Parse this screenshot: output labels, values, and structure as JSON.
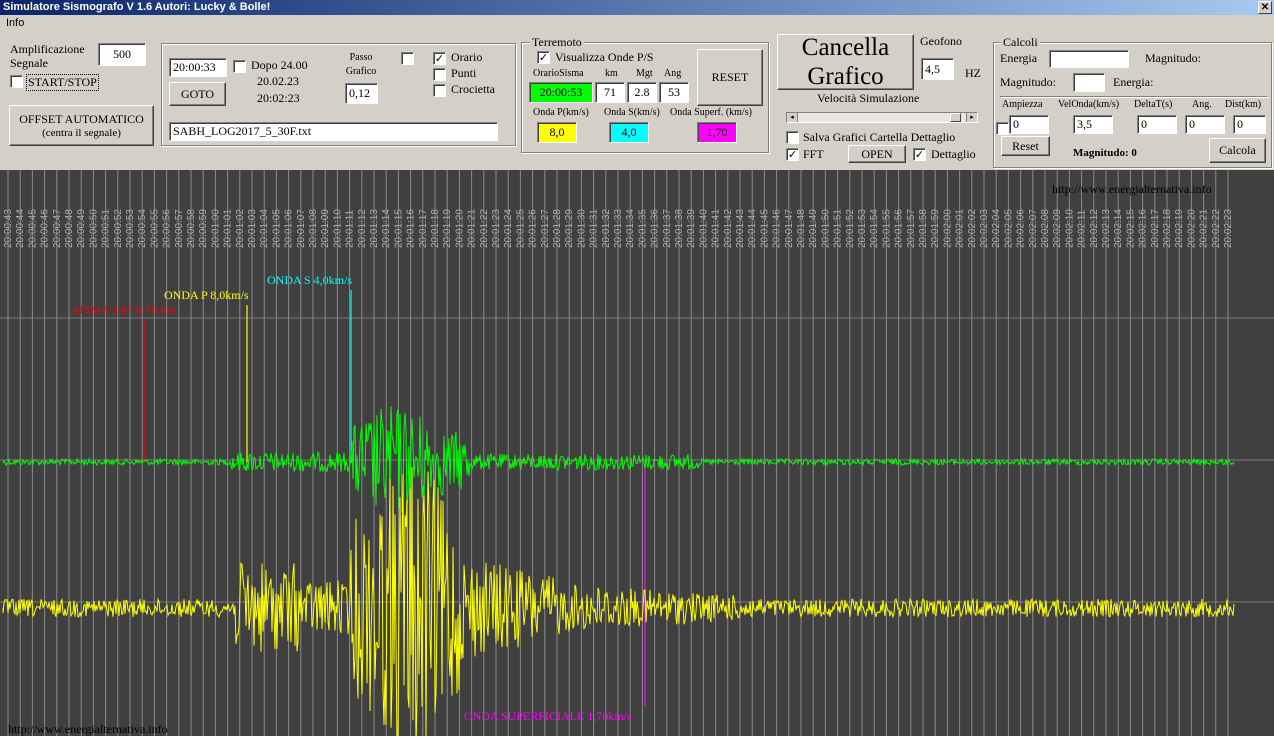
{
  "window": {
    "title": "Simulatore Sismografo V 1.6  Autori: Lucky & Bolle!",
    "close_glyph": "✕"
  },
  "menu": {
    "info": "Info"
  },
  "amplification": {
    "label_line1": "Amplificazione",
    "label_line2": "Segnale",
    "value": "500",
    "start_stop_label": "START/STOP",
    "start_stop_checked": false
  },
  "offset": {
    "line1": "OFFSET AUTOMATICO",
    "line2": "(centra il segnale)"
  },
  "time_group": {
    "time_value": "20:00:33",
    "dopo_label": "Dopo 24.00",
    "dopo_checked": false,
    "date": "20.02.23",
    "time2": "20:02:23",
    "goto_label": "GOTO",
    "passo_line1": "Passo",
    "passo_line2": "Grafico",
    "passo_value": "0,12",
    "extra_checked": false,
    "orario_label": "Orario",
    "orario_checked": true,
    "punti_label": "Punti",
    "punti_checked": false,
    "crocietta_label": "Crocietta",
    "crocietta_checked": false,
    "file_name": "SABH_LOG2017_5_30F.txt"
  },
  "terremoto": {
    "title": "Terremoto",
    "visualizza_label": "Visualizza Onde P/S",
    "visualizza_checked": true,
    "col_orario": "OrarioSisma",
    "col_km": "km",
    "col_mgt": "Mgt",
    "col_ang": "Ang",
    "orario_value": "20:00:53",
    "km_value": "71",
    "mgt_value": "2.8",
    "ang_value": "53",
    "reset_label": "RESET",
    "onda_p_label": "Onda P(km/s)",
    "onda_s_label": "Onda S(km/s)",
    "onda_sup_label": "Onda Superf. (km/s)",
    "onda_p_value": "8,0",
    "onda_s_value": "4,0",
    "onda_sup_value": "1,70",
    "color_p": "#ffff00",
    "color_s": "#00ffff",
    "color_sup": "#ff00ff",
    "color_orario": "#00ff00"
  },
  "graph_controls": {
    "cancella_line1": "Cancella",
    "cancella_line2": "Grafico",
    "geofono_label": "Geofono",
    "geofono_value": "4,5",
    "hz_label": "HZ",
    "velocita_label": "Velocità Simulazione",
    "slider_fraction": 0.97,
    "salva_label": "Salva Grafici Cartella Dettaglio",
    "salva_checked": false,
    "fft_label": "FFT",
    "fft_checked": true,
    "open_label": "OPEN",
    "dettaglio_label": "Dettaglio",
    "dettaglio_checked": true
  },
  "calcoli": {
    "title": "Calcoli",
    "energia_label": "Energia",
    "energia_value": "",
    "magnitudo_label": "Magnitudo:",
    "magnitudo2_label": "Magnitudo:",
    "magnitudo2_value": "",
    "energia2_label": "Energia:",
    "col_ampiezza": "Ampiezza",
    "col_velonda": "VelOnda(km/s)",
    "col_deltat": "DeltaT(s)",
    "col_ang": "Ang.",
    "col_dist": "Dist(km)",
    "ampiezza_value": "0",
    "velonda_value": "3,5",
    "deltat_value": "0",
    "ang_value": "0",
    "dist_value": "0",
    "row_checked": false,
    "reset_label": "Reset",
    "magnitudo_result": "Magnitudo:  0",
    "calcola_label": "Calcola"
  },
  "plot": {
    "watermark_top": "http://www.energialternativa.info",
    "watermark_bottom": "http://www.energialternativa.info",
    "label_sisma": "SISMA 2.8° A 70.8m",
    "label_p": "ONDA P 8,0km/s",
    "label_s": "ONDA S 4,0km/s",
    "label_sup": "ONDA SUPERFICIALE 1,70km/s",
    "color_sisma": "#ff0000",
    "color_p": "#ffff00",
    "color_s": "#00ffff",
    "color_sup": "#ff00ff",
    "trace1_color": "#00ff00",
    "trace2_color": "#ffff00",
    "time_ticks": [
      "20:00:43",
      "20:00:44",
      "20:00:45",
      "20:00:46",
      "20:00:47",
      "20:00:48",
      "20:00:49",
      "20:00:50",
      "20:00:51",
      "20:00:52",
      "20:00:53",
      "20:00:54",
      "20:00:55",
      "20:00:56",
      "20:00:57",
      "20:00:58",
      "20:00:59",
      "20:01:00",
      "20:01:01",
      "20:01:02",
      "20:01:03",
      "20:01:04",
      "20:01:05",
      "20:01:06",
      "20:01:07",
      "20:01:08",
      "20:01:09",
      "20:01:10",
      "20:01:11",
      "20:01:12",
      "20:01:13",
      "20:01:14",
      "20:01:15",
      "20:01:16",
      "20:01:17",
      "20:01:18",
      "20:01:19",
      "20:01:20",
      "20:01:21",
      "20:01:22",
      "20:01:23",
      "20:01:24",
      "20:01:25",
      "20:01:26",
      "20:01:27",
      "20:01:28",
      "20:01:29",
      "20:01:30",
      "20:01:31",
      "20:01:32",
      "20:01:33",
      "20:01:34",
      "20:01:35",
      "20:01:36",
      "20:01:37",
      "20:01:38",
      "20:01:39",
      "20:01:40",
      "20:01:41",
      "20:01:42",
      "20:01:43",
      "20:01:44",
      "20:01:45",
      "20:01:46",
      "20:01:47",
      "20:01:48",
      "20:01:49",
      "20:01:50",
      "20:01:51",
      "20:01:52",
      "20:01:53",
      "20:01:54",
      "20:01:55",
      "20:01:56",
      "20:01:57",
      "20:01:58",
      "20:01:59",
      "20:02:00",
      "20:02:01",
      "20:02:02",
      "20:02:03",
      "20:02:04",
      "20:02:05",
      "20:02:06",
      "20:02:07",
      "20:02:08",
      "20:02:09",
      "20:02:10",
      "20:02:11",
      "20:02:12",
      "20:02:13",
      "20:02:14",
      "20:02:15",
      "20:02:16",
      "20:02:17",
      "20:02:18",
      "20:02:19",
      "20:02:20",
      "20:02:21",
      "20:02:22",
      "20:02:23"
    ]
  }
}
